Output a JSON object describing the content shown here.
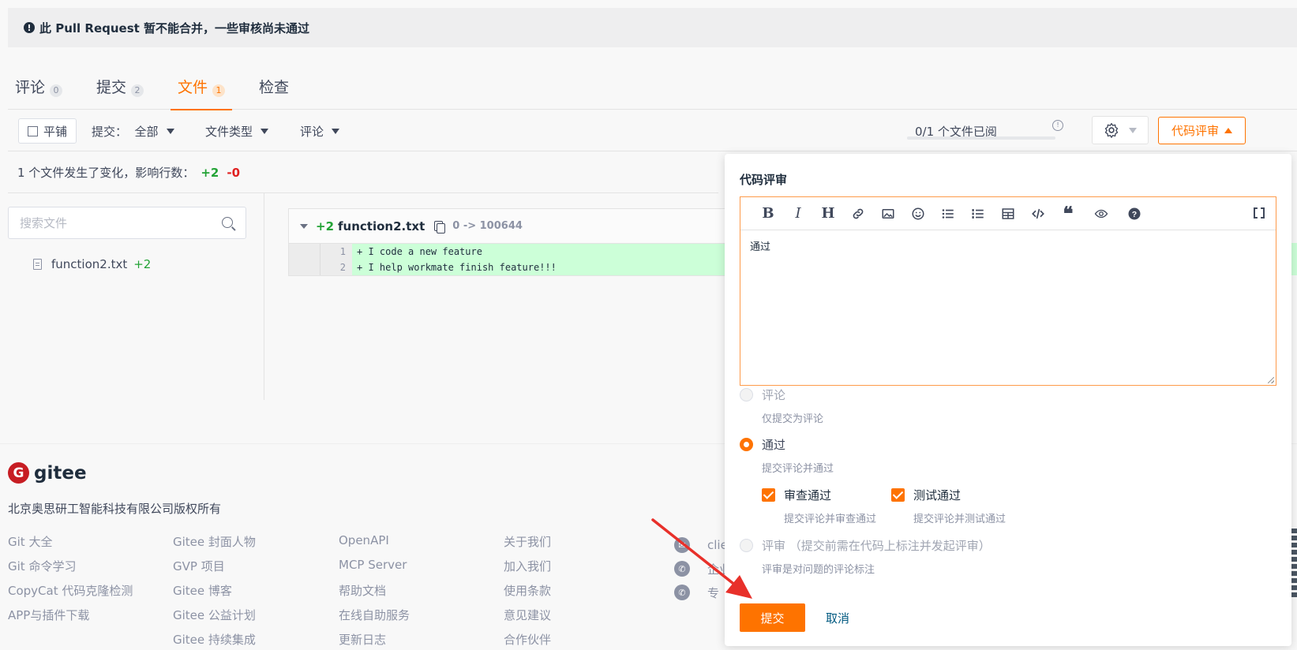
{
  "banner": {
    "icon": "alert-circle-icon",
    "text": "此 Pull Request 暂不能合并，一些审核尚未通过"
  },
  "tabs": [
    {
      "label": "评论",
      "count": "0"
    },
    {
      "label": "提交",
      "count": "2"
    },
    {
      "label": "文件",
      "count": "1"
    },
    {
      "label": "检查",
      "count": ""
    }
  ],
  "toolbar": {
    "tile_label": "平铺",
    "commit_filter": "提交：  全部",
    "filetype_filter": "文件类型",
    "comment_filter": "评论",
    "review_progress": "0/1 个文件已阅",
    "code_review_label": "代码评审"
  },
  "summary": {
    "text": "1 个文件发生了变化，影响行数：",
    "additions": "+2",
    "deletions": "-0"
  },
  "sidebar": {
    "search_placeholder": "搜索文件",
    "files": [
      {
        "name": "function2.txt",
        "additions": "+2"
      }
    ]
  },
  "diff": {
    "additions": "+2",
    "filename": "function2.txt",
    "mode": "0 -> 100644",
    "lines": [
      {
        "num": "1",
        "text": "+ I code a new feature"
      },
      {
        "num": "2",
        "text": "+ I help workmate finish feature!!!"
      }
    ]
  },
  "footer": {
    "brand": "gitee",
    "copyright": "北京奥思研工智能科技有限公司版权所有",
    "col1": [
      "Git 大全",
      "Git 命令学习",
      "CopyCat 代码克隆检测",
      "APP与插件下载"
    ],
    "col2": [
      "Gitee 封面人物",
      "GVP 项目",
      "Gitee 博客",
      "Gitee 公益计划",
      "Gitee 持续集成"
    ],
    "col3": [
      "OpenAPI",
      "MCP Server",
      "帮助文档",
      "在线自助服务",
      "更新日志"
    ],
    "col4": [
      "关于我们",
      "加入我们",
      "使用条款",
      "意见建议",
      "合作伙伴"
    ],
    "contact": [
      "clie",
      "企业",
      "专"
    ]
  },
  "review": {
    "title": "代码评审",
    "toolbar_icons": [
      "bold-icon",
      "italic-icon",
      "heading-icon",
      "link-icon",
      "image-icon",
      "emoji-icon",
      "bullet-list-icon",
      "numbered-list-icon",
      "table-icon",
      "code-icon",
      "quote-icon",
      "preview-icon",
      "help-icon",
      "fullscreen-icon"
    ],
    "content": "通过",
    "options": [
      {
        "label": "评论",
        "desc": "仅提交为评论",
        "selected": false
      },
      {
        "label": "通过",
        "desc": "提交评论并通过",
        "selected": true
      },
      {
        "label": "评审 （提交前需在代码上标注并发起评审）",
        "desc": "评审是对问题的评论标注",
        "selected": false
      }
    ],
    "checks": [
      {
        "label": "审查通过",
        "desc": "提交评论并审查通过",
        "checked": true
      },
      {
        "label": "测试通过",
        "desc": "提交评论并测试通过",
        "checked": true
      }
    ],
    "submit_label": "提交",
    "cancel_label": "取消"
  },
  "colors": {
    "accent": "#fe7300",
    "addition": "#23a336",
    "deletion": "#e02020",
    "added_line_bg": "#ccffd8"
  }
}
